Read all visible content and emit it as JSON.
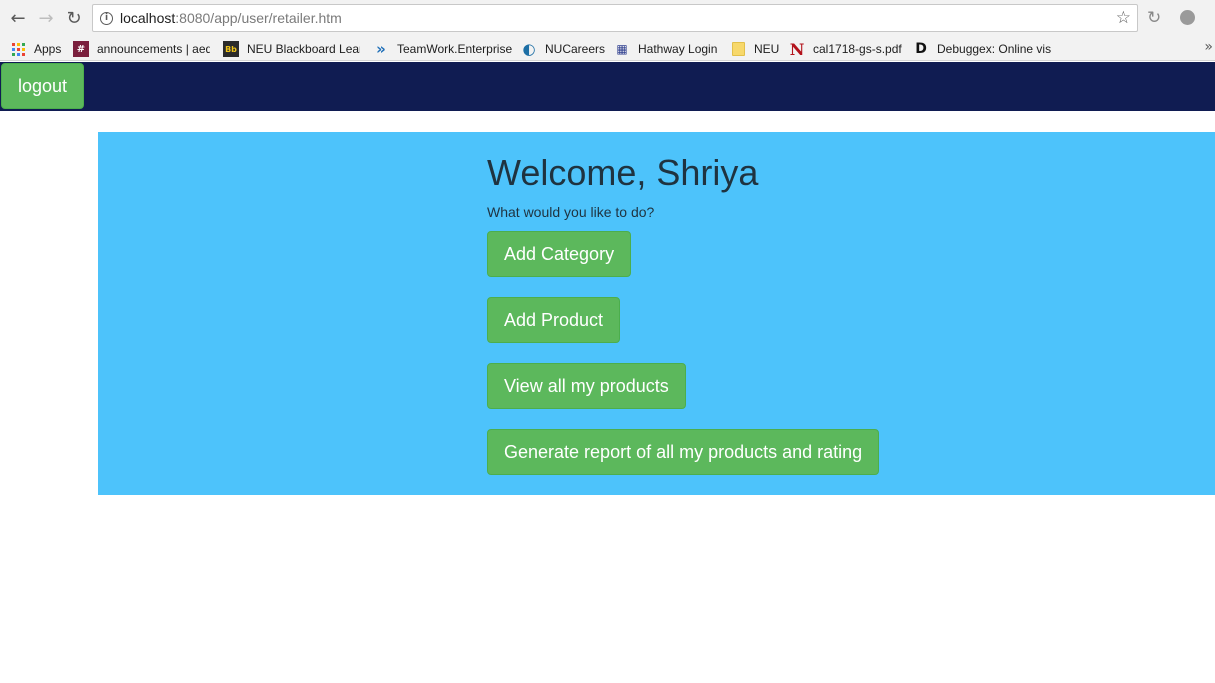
{
  "browser": {
    "url_host": "localhost",
    "url_rest": ":8080/app/user/retailer.htm",
    "bookmarks": [
      {
        "label": "Apps",
        "icon": "apps-grid-icon"
      },
      {
        "label": "announcements | aed",
        "icon": "slack-icon"
      },
      {
        "label": "NEU Blackboard Learn",
        "icon": "blackboard-icon"
      },
      {
        "label": "TeamWork.Enterprise",
        "icon": "teamwork-icon"
      },
      {
        "label": "NUCareers",
        "icon": "nucareers-icon"
      },
      {
        "label": "Hathway Login",
        "icon": "hathway-icon"
      },
      {
        "label": "NEU",
        "icon": "folder-icon"
      },
      {
        "label": "cal1718-gs-s.pdf",
        "icon": "neu-logo-icon"
      },
      {
        "label": "Debuggex: Online vis",
        "icon": "debuggex-icon"
      }
    ],
    "overflow_glyph": "»"
  },
  "header": {
    "logout_label": "logout"
  },
  "main": {
    "welcome": "Welcome, Shriya",
    "prompt": "What would you like to do?",
    "actions": [
      "Add Category",
      "Add Product",
      "View all my products",
      "Generate report of all my products and rating"
    ]
  },
  "colors": {
    "header_bg": "#101c52",
    "panel_bg": "#4dc3fb",
    "button_green": "#5cb85c"
  }
}
